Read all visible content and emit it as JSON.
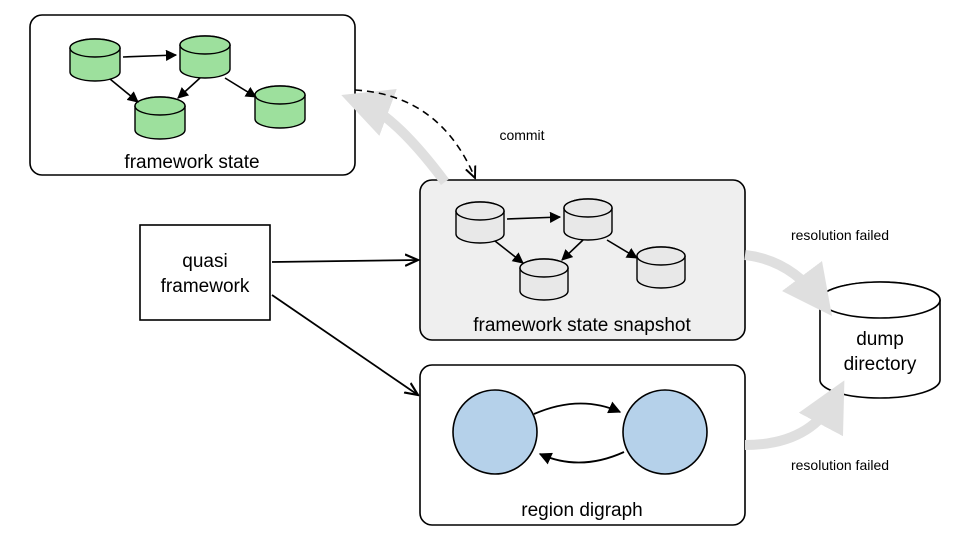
{
  "boxes": {
    "framework_state": {
      "label": "framework state"
    },
    "quasi_framework": {
      "label_line1": "quasi",
      "label_line2": "framework"
    },
    "snapshot": {
      "label": "framework state snapshot"
    },
    "region_digraph": {
      "label": "region digraph"
    },
    "dump_directory": {
      "label_line1": "dump",
      "label_line2": "directory"
    }
  },
  "edges": {
    "commit": "commit",
    "resolution_failed_top": "resolution failed",
    "resolution_failed_bottom": "resolution failed"
  },
  "colors": {
    "green_cyl": "#9de09d",
    "gray_cyl": "#e8e8e8",
    "blue_circle": "#b5d1ea",
    "snapshot_bg": "#efefef",
    "light_arrow": "#dfdfdf"
  }
}
